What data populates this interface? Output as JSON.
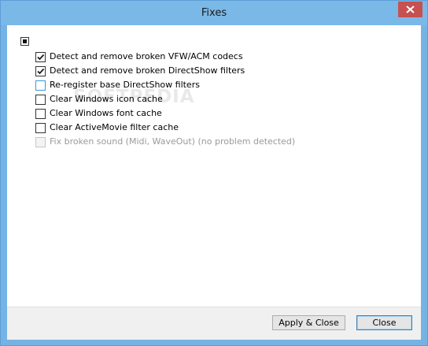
{
  "window": {
    "title": "Fixes"
  },
  "fixes": [
    {
      "label": "Detect and remove broken VFW/ACM codecs",
      "checked": true,
      "state": "normal"
    },
    {
      "label": "Detect and remove broken DirectShow filters",
      "checked": true,
      "state": "normal"
    },
    {
      "label": "Re-register base DirectShow filters",
      "checked": false,
      "state": "hover"
    },
    {
      "label": "Clear Windows icon cache",
      "checked": false,
      "state": "normal"
    },
    {
      "label": "Clear Windows font cache",
      "checked": false,
      "state": "normal"
    },
    {
      "label": "Clear ActiveMovie filter cache",
      "checked": false,
      "state": "normal"
    },
    {
      "label": "Fix broken sound (Midi, WaveOut)  (no problem detected)",
      "checked": false,
      "state": "disabled"
    }
  ],
  "watermark": "SOFTPEDIA",
  "buttons": {
    "apply_close": "Apply & Close",
    "close": "Close"
  },
  "colors": {
    "titlebar": "#7ab8e8",
    "close_hover": "#c75050",
    "check": "#1a1a1a"
  }
}
